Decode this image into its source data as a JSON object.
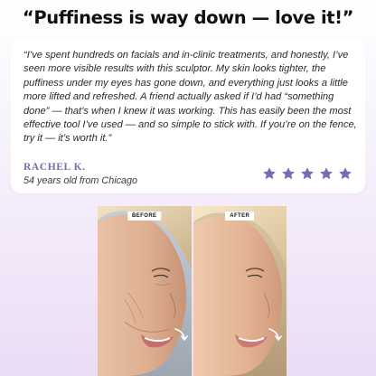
{
  "headline": "“Puffiness is way down — love it!”",
  "review": {
    "quote": "“I’ve spent hundreds on facials and in-clinic treatments, and honestly, I’ve seen more visible results with this sculptor. My skin looks tighter, the puffiness under my eyes has gone down, and everything just looks a little more lifted and refreshed.  A friend actually asked if I’d had “something done” — that’s when I knew it was working.  This has easily been the most effective tool I’ve used — and so simple to stick with. If you’re on the fence, try it — it’s worth it.”",
    "reviewer_name": "RACHEL K.",
    "reviewer_meta": "54 years old from Chicago",
    "rating": 5,
    "star_color": "#7d69b0"
  },
  "comparison": {
    "before_label": "BEFORE",
    "after_label": "AFTER",
    "before_icon": "curved-arrow-icon",
    "after_icon": "curved-arrow-icon"
  },
  "colors": {
    "accent": "#7d69b0",
    "background_bottom": "#ebdcf6",
    "card": "#ffffff"
  }
}
